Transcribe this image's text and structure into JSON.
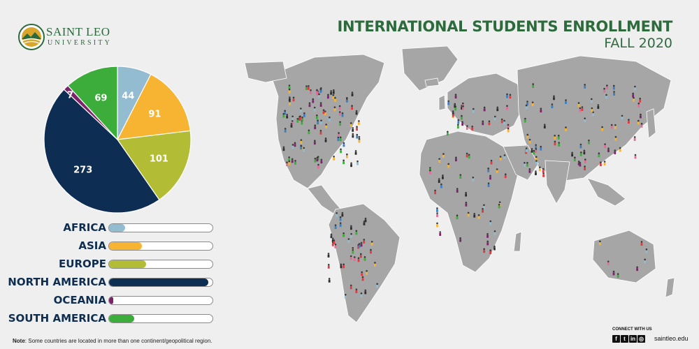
{
  "header": {
    "title": "INTERNATIONAL STUDENTS ENROLLMENT",
    "subtitle": "FALL 2020"
  },
  "logo": {
    "line1": "SAINT LEO",
    "line2": "UNIVERSITY",
    "primary_color": "#2a6a3b"
  },
  "chart_data": [
    {
      "type": "pie",
      "categories": [
        "AFRICA",
        "ASIA",
        "EUROPE",
        "NORTH AMERICA",
        "OCEANIA",
        "SOUTH AMERICA"
      ],
      "values": [
        44,
        91,
        101,
        273,
        7,
        69
      ],
      "labels": [
        "44",
        "91",
        "101",
        "273",
        "7",
        "69"
      ],
      "colors": [
        "#93bcd1",
        "#f7b432",
        "#b2bd35",
        "#0d2d52",
        "#7b2469",
        "#3cac3a"
      ]
    },
    {
      "type": "bar",
      "categories": [
        "AFRICA",
        "ASIA",
        "EUROPE",
        "NORTH AMERICA",
        "OCEANIA",
        "SOUTH AMERICA"
      ],
      "values": [
        44,
        91,
        101,
        273,
        7,
        69
      ],
      "colors": [
        "#93bcd1",
        "#f7b432",
        "#b2bd35",
        "#0d2d52",
        "#7b2469",
        "#3cac3a"
      ],
      "xlim": [
        0,
        280
      ]
    }
  ],
  "map": {
    "land_color": "#a6a6a6",
    "marker_colors": [
      "#e03a3e",
      "#f7b432",
      "#3b7fc4",
      "#2e2e2e",
      "#3cac3a",
      "#7b2469",
      "#93bcd1",
      "#e36c9a"
    ]
  },
  "footer": {
    "note_label": "Note",
    "note_text": ": Some countries are located in more than one continent/geopolitical region.",
    "connect_label": "CONNECT WITH US",
    "social_icons": [
      "facebook-icon",
      "twitter-icon",
      "linkedin-icon",
      "instagram-icon"
    ],
    "social_glyphs": [
      "f",
      "t",
      "in",
      "◎"
    ],
    "site": "saintleo.edu"
  }
}
